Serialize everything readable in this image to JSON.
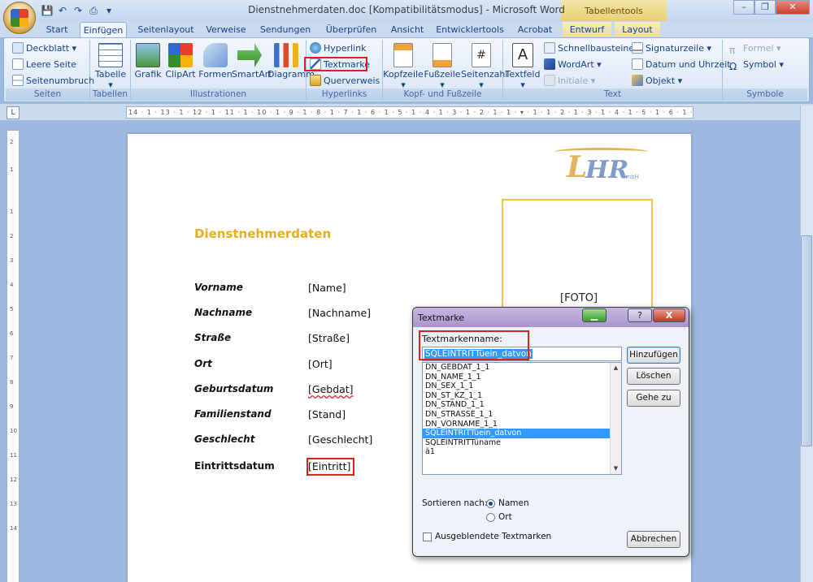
{
  "window": {
    "title": "Dienstnehmerdaten.doc [Kompatibilitätsmodus] - Microsoft Word",
    "context_tab_title": "Tabellentools"
  },
  "tabs": [
    {
      "label": "Start"
    },
    {
      "label": "Einfügen"
    },
    {
      "label": "Seitenlayout"
    },
    {
      "label": "Verweise"
    },
    {
      "label": "Sendungen"
    },
    {
      "label": "Überprüfen"
    },
    {
      "label": "Ansicht"
    },
    {
      "label": "Entwicklertools"
    },
    {
      "label": "Acrobat"
    },
    {
      "label": "Entwurf"
    },
    {
      "label": "Layout"
    }
  ],
  "ribbon": {
    "seiten": {
      "label": "Seiten",
      "deckblatt": "Deckblatt",
      "leere_seite": "Leere Seite",
      "seitenumbruch": "Seitenumbruch"
    },
    "tabellen": {
      "label": "Tabellen",
      "tabelle": "Tabelle"
    },
    "illustrationen": {
      "label": "Illustrationen",
      "grafik": "Grafik",
      "clipart": "ClipArt",
      "formen": "Formen",
      "smartart": "SmartArt",
      "diagramm": "Diagramm"
    },
    "hyperlinks": {
      "label": "Hyperlinks",
      "hyperlink": "Hyperlink",
      "textmarke": "Textmarke",
      "querverweis": "Querverweis"
    },
    "kopf": {
      "label": "Kopf- und Fußzeile",
      "kopfzeile": "Kopfzeile",
      "fusszeile": "Fußzeile",
      "seitenzahl": "Seitenzahl"
    },
    "text": {
      "label": "Text",
      "textfeld": "Textfeld",
      "schnellbausteine": "Schnellbausteine",
      "wordart": "WordArt",
      "initiale": "Initiale",
      "signaturzeile": "Signaturzeile",
      "datum": "Datum und Uhrzeit",
      "objekt": "Objekt"
    },
    "symbole": {
      "label": "Symbole",
      "formel": "Formel",
      "symbol": "Symbol"
    }
  },
  "ruler": {
    "horizontal": "14 · 1 · 13 · 1 · 12 · 1 · 11 · 1 · 10 · 1 · 9 · 1 · 8 · 1 · 7 · 1 · 6 · 1 · 5 · 1 · 4 · 1 · 3 · 1 · 2 · 1 · 1 · ▾ · 1 · 1 · 2 · 1 · 3 · 1 · 4 · 1 · 5 · 1 · 6 · 1 · 7 · 1 · 8",
    "vertical": [
      "2",
      "1",
      "1",
      "2",
      "3",
      "4",
      "5",
      "6",
      "7",
      "8",
      "9",
      "10",
      "11",
      "12",
      "13",
      "14"
    ]
  },
  "document": {
    "logo": {
      "letter_l": "L",
      "letters_hr": "HR",
      "gmbh": "GmbH"
    },
    "foto_label": "[FOTO]",
    "title": "Dienstnehmerdaten",
    "fields": [
      {
        "label": "Vorname",
        "value": "[Name]"
      },
      {
        "label": "Nachname",
        "value": "[Nachname]"
      },
      {
        "label": "Straße",
        "value": "[Straße]"
      },
      {
        "label": "Ort",
        "value": "[Ort]"
      },
      {
        "label": "Geburtsdatum",
        "value": "[Gebdat]"
      },
      {
        "label": "Familienstand",
        "value": "[Stand]"
      },
      {
        "label": "Geschlecht",
        "value": "[Geschlecht]"
      },
      {
        "label": "Eintrittsdatum",
        "value": "[Eintritt]"
      }
    ]
  },
  "dialog": {
    "title": "Textmarke",
    "name_label": "Textmarkenname:",
    "name_value": "SQLEINTRITTüein_datvon",
    "bookmarks": [
      "DN_GEBDAT_1_1",
      "DN_NAME_1_1",
      "DN_SEX_1_1",
      "DN_ST_KZ_1_1",
      "DN_STAND_1_1",
      "DN_STRASSE_1_1",
      "DN_VORNAME_1_1",
      "SQLEINTRITTüein_datvon",
      "SQLEINTRITTüname",
      "ä1"
    ],
    "selected_index": 7,
    "btn_add": "Hinzufügen",
    "btn_delete": "Löschen",
    "btn_goto": "Gehe zu",
    "btn_cancel": "Abbrechen",
    "sort_label": "Sortieren nach:",
    "sort_name": "Namen",
    "sort_place": "Ort",
    "hidden_label": "Ausgeblendete Textmarken",
    "help": "?",
    "close": "X"
  }
}
